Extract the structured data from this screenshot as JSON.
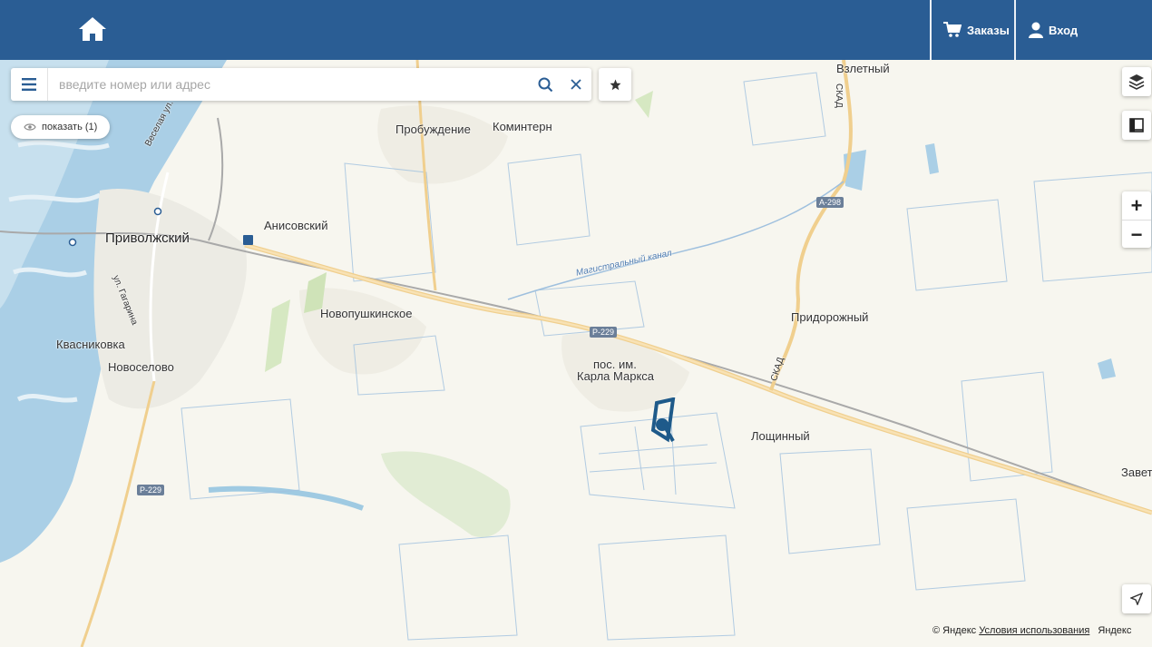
{
  "header": {
    "background": "#2a5d94",
    "home_icon": "home-icon",
    "orders_label": "Заказы",
    "login_label": "Вход"
  },
  "search": {
    "placeholder": "введите номер или адрес"
  },
  "show_button": {
    "label": "показать (1)"
  },
  "map": {
    "places": {
      "vzletny": "Взлетный",
      "probuzhdenie": "Пробуждение",
      "komintern": "Коминтерн",
      "anisovsky": "Анисовский",
      "privolzhsky": "Приволжский",
      "novopushkinskoe": "Новопушкинское",
      "pridorozhny": "Придорожный",
      "kvasnikovka": "Квасниковка",
      "novoselovo": "Новоселово",
      "karla_marksa_1": "пос. им.",
      "karla_marksa_2": "Карла Маркса",
      "loshchinny": "Лощинный",
      "zavet": "Завет"
    },
    "streets": {
      "veselaya": "Веселая ул.",
      "gagarina": "ул. Гагарина",
      "skad": "СКАД",
      "kanal": "Магистральный канал"
    },
    "road_badges": {
      "a298": "А-298",
      "r229a": "Р-229",
      "r229b": "Р-229"
    },
    "marker_color": "#1e5a8a",
    "water_color": "#aacfe6"
  },
  "attribution": {
    "copyright": "© Яндекс",
    "terms": "Условия использования",
    "brand": "Яндекс"
  }
}
